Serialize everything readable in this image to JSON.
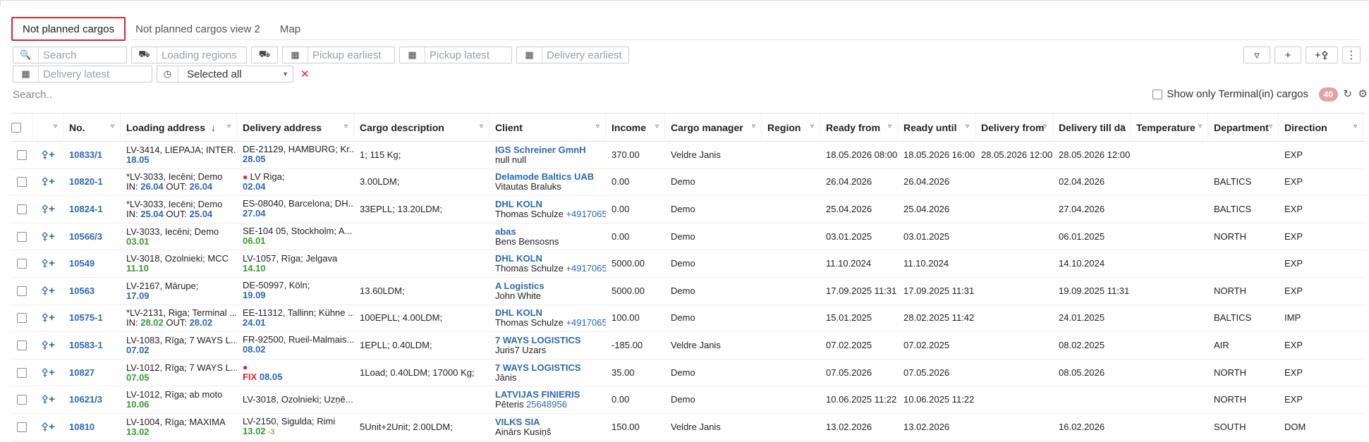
{
  "tabs": [
    {
      "label": "Not planned cargos",
      "active": true
    },
    {
      "label": "Not planned cargos view 2",
      "active": false
    },
    {
      "label": "Map",
      "active": false
    }
  ],
  "filters": {
    "search_placeholder": "Search",
    "loading_regions_placeholder": "Loading regions",
    "pickup_earliest_placeholder": "Pickup earliest",
    "pickup_latest_placeholder": "Pickup latest",
    "delivery_earliest_placeholder": "Delivery earliest",
    "delivery_latest_placeholder": "Delivery latest",
    "status_select_value": "Selected all"
  },
  "table_search_placeholder": "Search..",
  "terminal_checkbox_label": "Show only Terminal(in) cargos",
  "count_badge": "40",
  "colors": {
    "accent": "#d9272e",
    "link": "#2f68b3",
    "green": "#3a9a36"
  },
  "columns": [
    "No.",
    "Loading address",
    "Delivery address",
    "Cargo description",
    "Client",
    "Income",
    "Cargo manager",
    "Region",
    "Ready from",
    "Ready until",
    "Delivery from",
    "Delivery till da",
    "Temperature",
    "Department",
    "Direction"
  ],
  "rows": [
    {
      "no": "10833/1",
      "load1": "LV-3414, LIEPAJA; INTER...",
      "load2a": "",
      "load2b": "18.05",
      "load2c": "",
      "load2d": "",
      "del_pin": false,
      "del1": "DE-21129, HAMBURG; Kr...",
      "del2a": "",
      "del2b": "28.05",
      "desc": "1; 115 Kg;",
      "client": "IGS Schreiner GmnH",
      "contact": "null null",
      "phone": "",
      "income": "370.00",
      "manager": "Veldre Janis",
      "region": "",
      "ready_from": "18.05.2026 08:00",
      "ready_until": "18.05.2026 16:00",
      "del_from": "28.05.2026 12:00",
      "del_till": "28.05.2026 12:00",
      "temp": "",
      "dept": "",
      "dir": "EXP"
    },
    {
      "no": "10820-1",
      "load1": "*LV-3033, Iecēni; Demo",
      "load2a": "IN: ",
      "load2b": "26.04",
      "load2c": " OUT: ",
      "load2d": "26.04",
      "del_pin": true,
      "del1": "LV Riga;",
      "del2a": "",
      "del2b": "02.04",
      "desc": "3.00LDM;",
      "client": "Delamode Baltics UAB",
      "contact": "Vitautas Braluks",
      "phone": "",
      "income": "0.00",
      "manager": "Demo",
      "region": "",
      "ready_from": "26.04.2026",
      "ready_until": "26.04.2026",
      "del_from": "",
      "del_till": "02.04.2026",
      "temp": "",
      "dept": "BALTICS",
      "dir": "EXP"
    },
    {
      "no": "10824-1",
      "load1": "*LV-3033, Iecēni; Demo",
      "load2a": "IN: ",
      "load2b": "25.04",
      "load2c": " OUT: ",
      "load2d": "25.04",
      "del_pin": false,
      "del1": "ES-08040, Barcelona; DH...",
      "del2a": "",
      "del2b": "27.04",
      "desc": "33EPLL; 13.20LDM;",
      "client": "DHL KOLN",
      "contact": "Thomas Schulze ",
      "phone": "+4917065",
      "income": "0.00",
      "manager": "Demo",
      "region": "",
      "ready_from": "25.04.2026",
      "ready_until": "25.04.2026",
      "del_from": "",
      "del_till": "27.04.2026",
      "temp": "",
      "dept": "BALTICS",
      "dir": "EXP"
    },
    {
      "no": "10566/3",
      "load1": "LV-3033, Iecēni; Demo",
      "load2a": "",
      "load2b": "03.01",
      "load2c": "",
      "load2d": "",
      "del_pin": false,
      "del1": "SE-104 05, Stockholm; A...",
      "del2a": "",
      "del2b": "06.01",
      "desc": "",
      "client": "abas",
      "contact": "Bens Bensosns",
      "phone": "",
      "income": "0.00",
      "manager": "Demo",
      "region": "",
      "ready_from": "03.01.2025",
      "ready_until": "03.01.2025",
      "del_from": "",
      "del_till": "06.01.2025",
      "temp": "",
      "dept": "NORTH",
      "dir": "EXP"
    },
    {
      "no": "10549",
      "load1": "LV-3018, Ozolnieki; MCC",
      "load2a": "",
      "load2b": "11.10",
      "load2c": "",
      "load2d": "",
      "del_pin": false,
      "del1": "LV-1057, Rīga; Jelgava",
      "del2a": "",
      "del2b": "14.10",
      "desc": "",
      "client": "DHL KOLN",
      "contact": "Thomas Schulze ",
      "phone": "+4917065",
      "income": "5000.00",
      "manager": "Demo",
      "region": "",
      "ready_from": "11.10.2024",
      "ready_until": "11.10.2024",
      "del_from": "",
      "del_till": "14.10.2024",
      "temp": "",
      "dept": "",
      "dir": "EXP"
    },
    {
      "no": "10563",
      "load1": "LV-2167, Mārupe;",
      "load2a": "",
      "load2b": "17.09",
      "load2c": "",
      "load2d": "",
      "del_pin": false,
      "del1": "DE-50997, Köln;",
      "del2a": "",
      "del2b": "19.09",
      "desc": "13.60LDM;",
      "client": "A Logistics",
      "contact": "John White",
      "phone": "",
      "income": "5000.00",
      "manager": "Demo",
      "region": "",
      "ready_from": "17.09.2025 11:31",
      "ready_until": "17.09.2025 11:31",
      "del_from": "",
      "del_till": "19.09.2025 11:31",
      "temp": "",
      "dept": "NORTH",
      "dir": "EXP"
    },
    {
      "no": "10575-1",
      "load1": "*LV-2131, Riga; Terminal ...",
      "load2a": "IN: ",
      "load2b": "28.02",
      "load2c": " OUT: ",
      "load2d": "28.02",
      "del_pin": false,
      "del1": "EE-11312, Tallinn; Kühne ...",
      "del2a": "",
      "del2b": "24.01",
      "desc": "100EPLL; 4.00LDM;",
      "client": "DHL KOLN",
      "contact": "Thomas Schulze ",
      "phone": "+4917065",
      "income": "100.00",
      "manager": "Demo",
      "region": "",
      "ready_from": "15.01.2025",
      "ready_until": "28.02.2025 11:42",
      "del_from": "",
      "del_till": "24.01.2025",
      "temp": "",
      "dept": "BALTICS",
      "dir": "IMP"
    },
    {
      "no": "10583-1",
      "load1": "LV-1083, Rīga; 7 WAYS L...",
      "load2a": "",
      "load2b": "07.02",
      "load2c": "",
      "load2d": "",
      "del_pin": false,
      "del1": "FR-92500, Rueil-Malmais...",
      "del2a": "",
      "del2b": "08.02",
      "desc": "1EPLL; 0.40LDM;",
      "client": "7 WAYS LOGISTICS",
      "contact": "Juris7 Uzars",
      "phone": "",
      "income": "-185.00",
      "manager": "Veldre Janis",
      "region": "",
      "ready_from": "07.02.2025",
      "ready_until": "07.02.2025",
      "del_from": "",
      "del_till": "08.02.2025",
      "temp": "",
      "dept": "AIR",
      "dir": "EXP"
    },
    {
      "no": "10827",
      "load1": "LV-1012, Rīga; 7 WAYS L...",
      "load2a": "",
      "load2b": "07.05",
      "load2c": "",
      "load2d": "",
      "del_pin": true,
      "del1": "",
      "del2a": "FIX ",
      "del2b": "08.05",
      "desc": "1Load; 0.40LDM; 17000 Kg;",
      "client": "7 WAYS LOGISTICS",
      "contact": "Jānis",
      "phone": "",
      "income": "35.00",
      "manager": "Demo",
      "region": "",
      "ready_from": "07.05.2026",
      "ready_until": "07.05.2026",
      "del_from": "",
      "del_till": "08.05.2026",
      "temp": "",
      "dept": "NORTH",
      "dir": "EXP"
    },
    {
      "no": "10621/3",
      "load1": "LV-1012, Rīga; ab moto",
      "load2a": "",
      "load2b": "10.06",
      "load2c": "",
      "load2d": "",
      "del_pin": false,
      "del1": "LV-3018, Ozolnieki; Uzņē...",
      "del2a": "",
      "del2b": "",
      "desc": "",
      "client": "LATVIJAS FINIERIS",
      "contact": "Pēteris ",
      "phone": "25648956",
      "income": "0.00",
      "manager": "Demo",
      "region": "",
      "ready_from": "10.06.2025 11:22",
      "ready_until": "10.06.2025 11:22",
      "del_from": "",
      "del_till": "",
      "temp": "",
      "dept": "NORTH",
      "dir": "EXP"
    },
    {
      "no": "10810",
      "load1": "LV-1004, Rīga; MAXIMA",
      "load2a": "",
      "load2b": "13.02",
      "load2c": "",
      "load2d": "",
      "del_pin": false,
      "del1": "LV-2150, Sigulda; Rimi",
      "del2a": "",
      "del2b": "13.02",
      "del2e": " -3",
      "desc": "5Unit+2Unit; 2.00LDM;",
      "client": "VILKS SIA",
      "contact": "Ainārs Kusiņš",
      "phone": "",
      "income": "150.00",
      "manager": "Veldre Janis",
      "region": "",
      "ready_from": "13.02.2026",
      "ready_until": "13.02.2026",
      "del_from": "",
      "del_till": "16.02.2026",
      "temp": "",
      "dept": "SOUTH",
      "dir": "DOM"
    }
  ]
}
